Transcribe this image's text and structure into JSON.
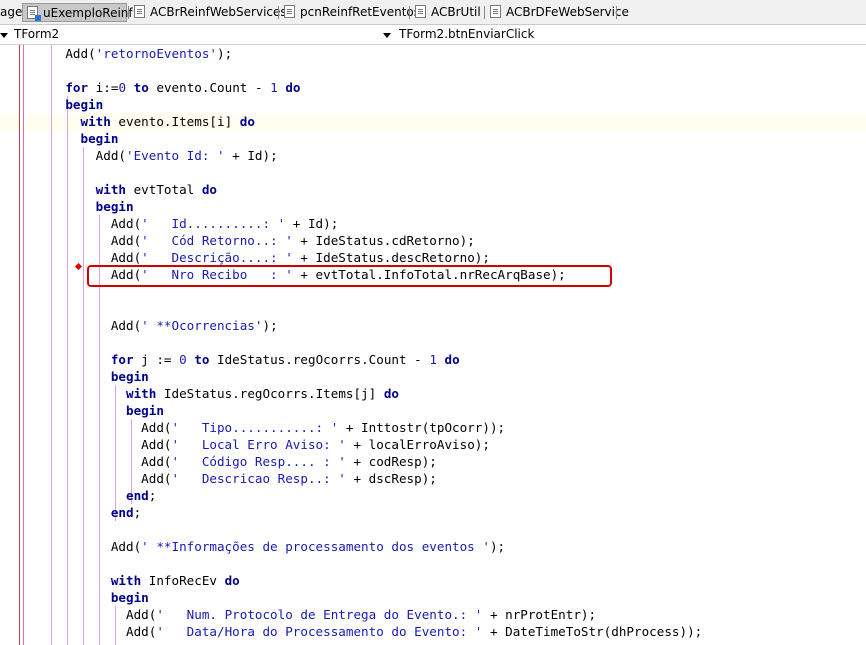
{
  "tabs": [
    {
      "label": "age",
      "active": false
    },
    {
      "label": "uExemploReinf",
      "active": true
    },
    {
      "label": "ACBrReinfWebServices",
      "active": false
    },
    {
      "label": "pcnReinfRetEventos",
      "active": false
    },
    {
      "label": "ACBrUtil",
      "active": false
    },
    {
      "label": "ACBrDFeWebService",
      "active": false
    }
  ],
  "combos": {
    "class_selector": "TForm2",
    "method_selector": "TForm2.btnEnviarClick"
  },
  "code_lines": [
    "    Add('retornoEventos');",
    "",
    "    for i:=0 to evento.Count - 1 do",
    "    begin",
    "      with evento.Items[i] do",
    "      begin",
    "        Add('Evento Id: ' + Id);",
    "",
    "        with evtTotal do",
    "        begin",
    "          Add('   Id..........: ' + Id);",
    "          Add('   Cód Retorno..: ' + IdeStatus.cdRetorno);",
    "          Add('   Descrição....: ' + IdeStatus.descRetorno);",
    "          Add('   Nro Recibo   : ' + evtTotal.InfoTotal.nrRecArqBase);",
    "",
    "",
    "          Add(' **Ocorrencias');",
    "",
    "          for j := 0 to IdeStatus.regOcorrs.Count - 1 do",
    "          begin",
    "            with IdeStatus.regOcorrs.Items[j] do",
    "            begin",
    "              Add('   Tipo...........: ' + Inttostr(tpOcorr));",
    "              Add('   Local Erro Aviso: ' + localErroAviso);",
    "              Add('   Código Resp.... : ' + codResp);",
    "              Add('   Descricao Resp..: ' + dscResp);",
    "            end;",
    "          end;",
    "",
    "          Add(' **Informações de processamento dos eventos ');",
    "",
    "          with InfoRecEv do",
    "          begin",
    "            Add('   Num. Protocolo de Entrega do Evento.: ' + nrProtEntr);",
    "            Add('   Data/Hora do Processamento do Evento: ' + DateTimeToStr(dhProcess));"
  ],
  "colors": {
    "keyword": "#00008b",
    "string": "#1a1ab0",
    "highlight_box": "#d40000"
  }
}
